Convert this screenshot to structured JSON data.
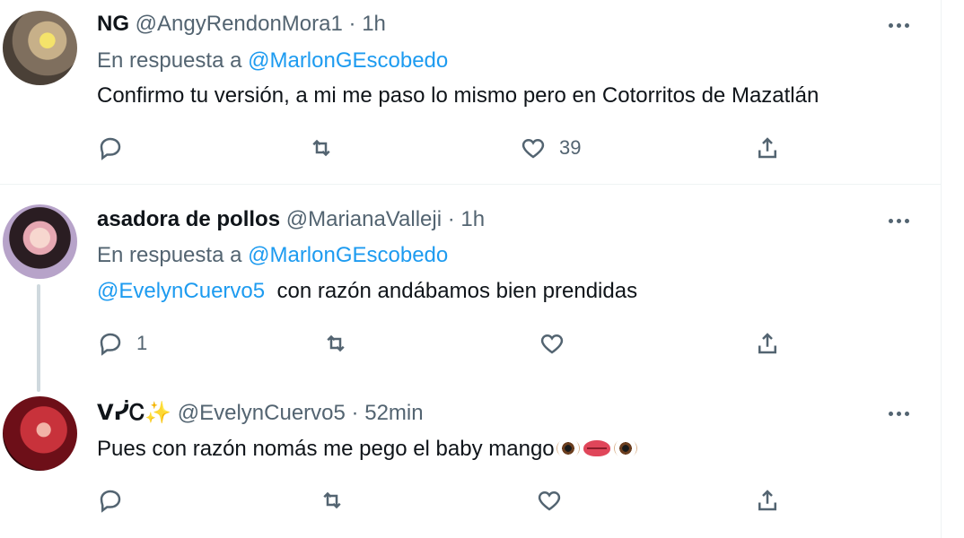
{
  "tweets": [
    {
      "name": "NG",
      "handle": "@AngyRendonMora1",
      "separator": "·",
      "time": "1h",
      "reply_prefix": "En respuesta a",
      "reply_to": "@MarlonGEscobedo",
      "text": "Confirmo tu versión, a mi me paso lo mismo pero en Cotorritos de Mazatlán",
      "reply_count": "",
      "retweet_count": "",
      "like_count": "39"
    },
    {
      "name": "asadora de pollos",
      "handle": "@MarianaValleji",
      "separator": "·",
      "time": "1h",
      "reply_prefix": "En respuesta a",
      "reply_to": "@MarlonGEscobedo",
      "text_mention": "@EvelynCuervo5",
      "text": "con razón andábamos bien prendidas",
      "reply_count": "1",
      "retweet_count": "",
      "like_count": ""
    },
    {
      "name": "ᐯᓰᏟ",
      "name_emoji": "✨",
      "handle": "@EvelynCuervo5",
      "separator": "·",
      "time": "52min",
      "text": "Pues con razón nomás me pego el baby mango",
      "reply_count": "",
      "retweet_count": "",
      "like_count": ""
    }
  ],
  "icons": {
    "reply": "reply-icon",
    "retweet": "retweet-icon",
    "like": "heart-icon",
    "share": "share-icon",
    "more": "more-icon"
  },
  "colors": {
    "link": "#1d9bf0",
    "secondary_text": "#536471",
    "divider": "#eff3f4"
  }
}
